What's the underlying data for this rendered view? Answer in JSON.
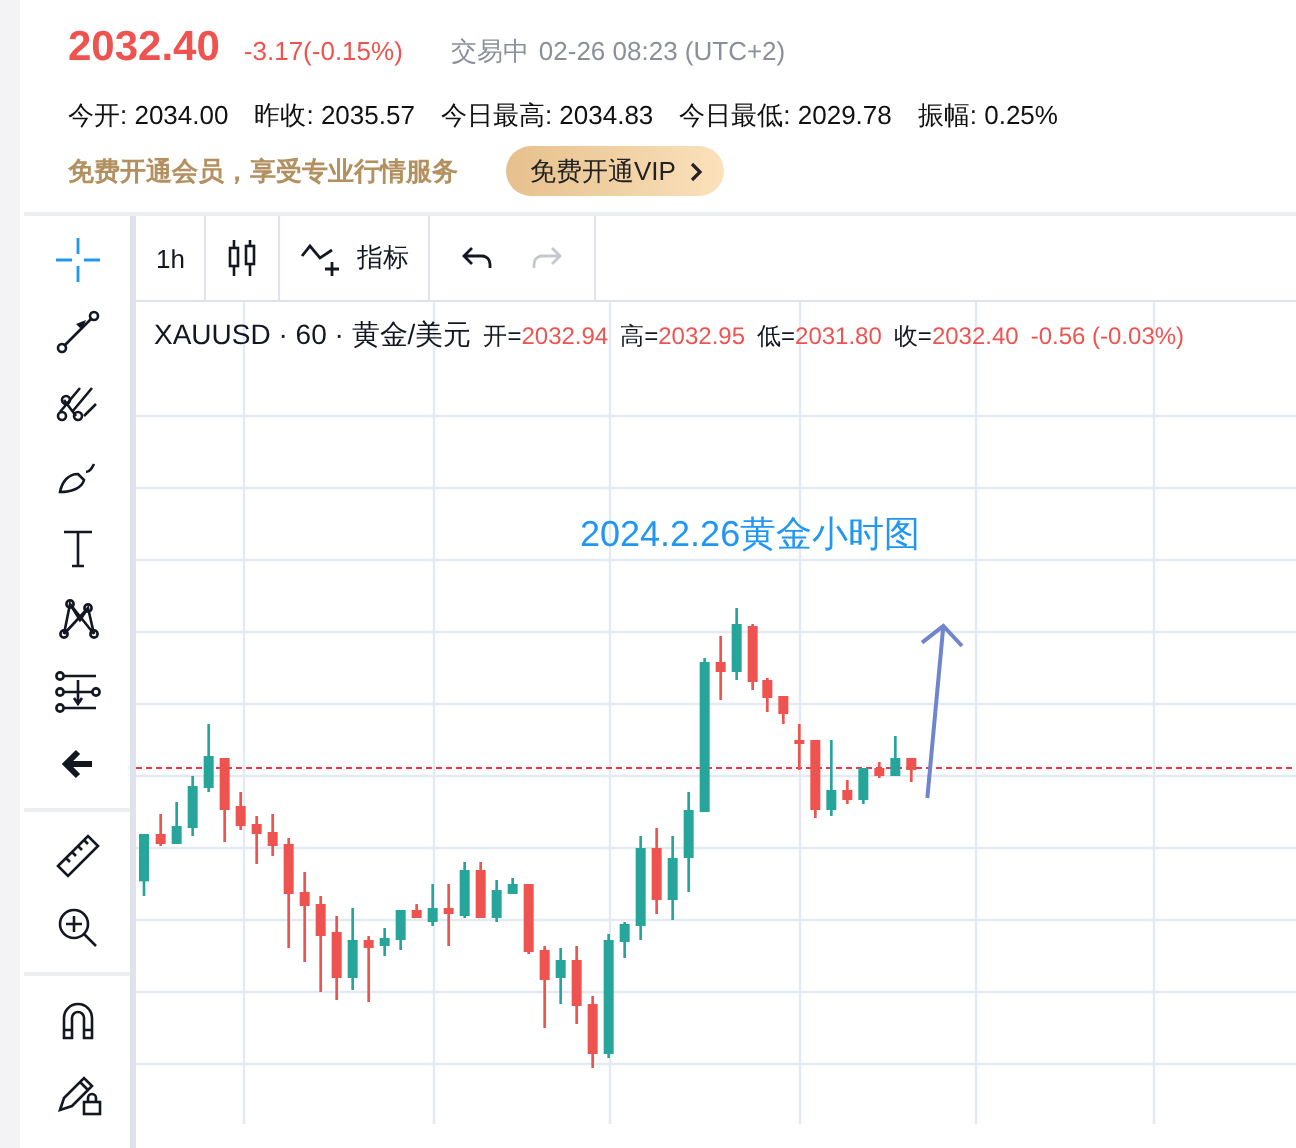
{
  "quote": {
    "price": "2032.40",
    "change": "-3.17(-0.15%)",
    "status": "交易中",
    "datetime": "02-26 08:23 (UTC+2)"
  },
  "stats": [
    {
      "label": "今开:",
      "value": "2034.00"
    },
    {
      "label": "昨收:",
      "value": "2035.57"
    },
    {
      "label": "今日最高:",
      "value": "2034.83"
    },
    {
      "label": "今日最低:",
      "value": "2029.78"
    },
    {
      "label": "振幅:",
      "value": "0.25%"
    }
  ],
  "promo": {
    "text": "免费开通会员，享受专业行情服务",
    "button": "免费开通VIP"
  },
  "toolbar": {
    "interval": "1h",
    "indicators": "指标",
    "redo_disabled": true
  },
  "legend": {
    "title": "XAUUSD · 60 · 黄金/美元",
    "values": [
      {
        "label": "开=",
        "value": "2032.94"
      },
      {
        "label": "高=",
        "value": "2032.95"
      },
      {
        "label": "低=",
        "value": "2031.80"
      },
      {
        "label": "收=",
        "value": "2032.40"
      }
    ],
    "change": "-0.56 (-0.03%)"
  },
  "chart": {
    "annotation": "2024.2.26黄金小时图"
  },
  "tool_groups": [
    [
      {
        "kind": "crosshair",
        "selected": true
      },
      {
        "kind": "trendline",
        "selected": false
      },
      {
        "kind": "pitchfork",
        "selected": false
      },
      {
        "kind": "brush",
        "selected": false
      },
      {
        "kind": "text",
        "selected": false
      },
      {
        "kind": "pattern",
        "selected": false
      },
      {
        "kind": "prediction",
        "selected": false
      },
      {
        "kind": "back",
        "selected": false
      }
    ],
    [
      {
        "kind": "ruler",
        "selected": false
      },
      {
        "kind": "zoom",
        "selected": false
      }
    ],
    [
      {
        "kind": "magnet",
        "selected": false
      },
      {
        "kind": "lock",
        "selected": false
      }
    ]
  ]
}
